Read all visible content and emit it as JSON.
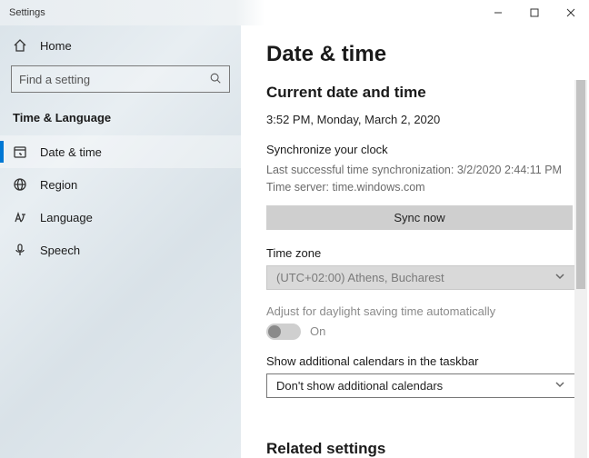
{
  "window": {
    "title": "Settings"
  },
  "sidebar": {
    "home": "Home",
    "search_placeholder": "Find a setting",
    "category": "Time & Language",
    "items": [
      {
        "label": "Date & time"
      },
      {
        "label": "Region"
      },
      {
        "label": "Language"
      },
      {
        "label": "Speech"
      }
    ]
  },
  "content": {
    "title": "Date & time",
    "section_current": "Current date and time",
    "datetime": "3:52 PM, Monday, March 2, 2020",
    "sync_header": "Synchronize your clock",
    "sync_last": "Last successful time synchronization: 3/2/2020 2:44:11 PM",
    "sync_server": "Time server: time.windows.com",
    "sync_button": "Sync now",
    "tz_label": "Time zone",
    "tz_value": "(UTC+02:00) Athens, Bucharest",
    "dst_label": "Adjust for daylight saving time automatically",
    "dst_state": "On",
    "cal_label": "Show additional calendars in the taskbar",
    "cal_value": "Don't show additional calendars",
    "related": "Related settings"
  }
}
